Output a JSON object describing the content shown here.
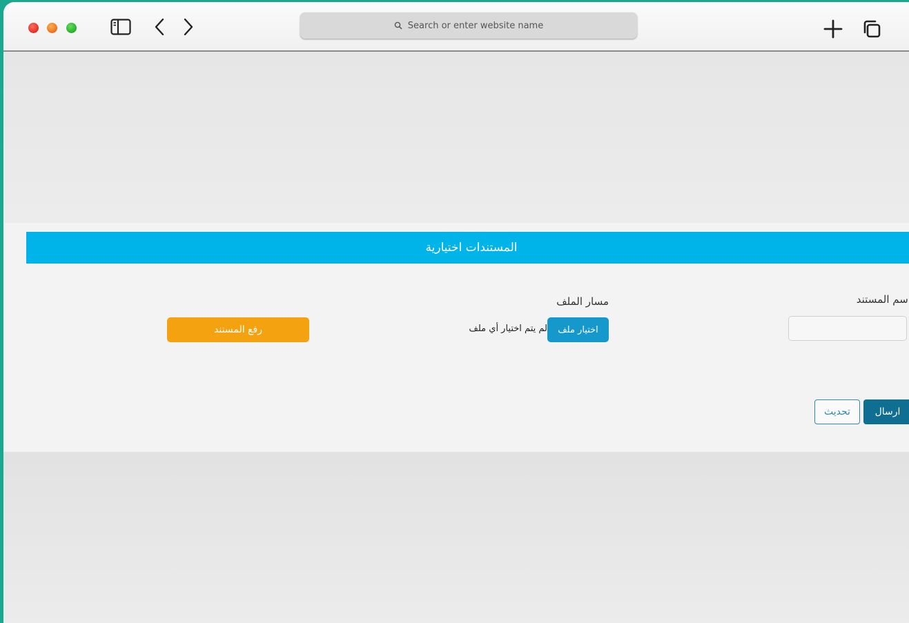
{
  "browser": {
    "address_placeholder": "Search or enter website name",
    "icons": {
      "sidebar": "sidebar-icon",
      "back": "chevron-left-icon",
      "forward": "chevron-right-icon",
      "search": "search-icon",
      "new_tab": "plus-icon",
      "tabs": "tabs-overview-icon"
    },
    "traffic_lights": [
      "#e0281c",
      "#f0661c",
      "#22b21f"
    ]
  },
  "form": {
    "header": "المستندات اختيارية",
    "document_name_label": "اسم المستند",
    "document_name_value": "",
    "file_path_label": "مسار الملف",
    "choose_file_label": "اختيار ملف",
    "no_file_text": "لم يتم اختيار أي ملف",
    "upload_label": "رفع المستند",
    "refresh_label": "تحديث",
    "send_label": "ارسال"
  },
  "colors": {
    "header": "#00b4ea",
    "choose_file": "#1598cc",
    "upload": "#f4a20f",
    "send": "#0e6f93",
    "refresh_border": "#2d8bb0",
    "background_outer": "#1aa98f"
  }
}
